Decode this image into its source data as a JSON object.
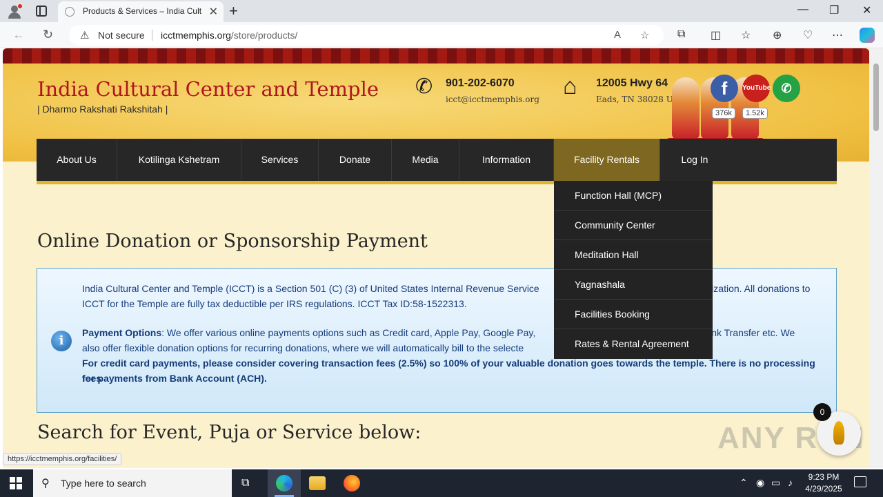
{
  "browser": {
    "tab_title": "Products & Services – India Cultu",
    "new_tab": "+",
    "tab_close": "✕",
    "window_minimize": "—",
    "window_restore": "❐",
    "window_close": "✕",
    "security_label": "Not secure",
    "url_domain": "icctmemphis.org",
    "url_path": "/store/products/",
    "status_url": "https://icctmemphis.org/facilities/"
  },
  "site": {
    "title": "India Cultural Center and Temple",
    "tagline": "| Dharmo Rakshati Rakshitah |",
    "phone": "901-202-6070",
    "email": "icct@icctmemphis.org",
    "address_line1": "12005 Hwy 64",
    "address_line2": "Eads, TN 38028 USA",
    "social": {
      "facebook_glyph": "f",
      "youtube_text": "YouTube",
      "whatsapp_glyph": "✆",
      "facebook_count": "376k",
      "youtube_count": "1.52k"
    }
  },
  "nav": {
    "items": [
      "About Us",
      "Kotilinga Kshetram",
      "Services",
      "Donate",
      "Media",
      "Information",
      "Facility Rentals",
      "Log In"
    ],
    "dropdown": [
      "Function Hall (MCP)",
      "Community Center",
      "Meditation Hall",
      "Yagnashala",
      "Facilities Booking",
      "Rates & Rental Agreement"
    ]
  },
  "content": {
    "heading": "Online Donation or Sponsorship Payment",
    "info_line1": "India Cultural Center and Temple (ICCT) is a Section 501 (C) (3) of United States Internal Revenue Service",
    "info_line1_tail": "anization. All donations to",
    "info_line2": "ICCT for the Temple are fully tax deductible per IRS regulations. ICCT Tax ID:58-1522313.",
    "payment_label": "Payment Options",
    "payment_text": ": We offer various online payments options such as Credit card, Apple Pay, Google Pay,",
    "payment_tail": "/Bank Transfer etc. We",
    "payment_line2": "also offer flexible donation options for recurring donations, where we will automatically bill to the selecte",
    "fee_line1": "For credit card payments, please consider covering transaction fees (2.5%) so 100% of your valuable donation goes towards the temple. There is no processing fees",
    "fee_line2": "for payments from Bank Account (ACH).",
    "search_heading": "Search for Event, Puja or Service below:",
    "badge": "0",
    "watermark": "ANY RUN"
  },
  "taskbar": {
    "search_placeholder": "Type here to search",
    "time": "9:23 PM",
    "date": "4/29/2025"
  }
}
